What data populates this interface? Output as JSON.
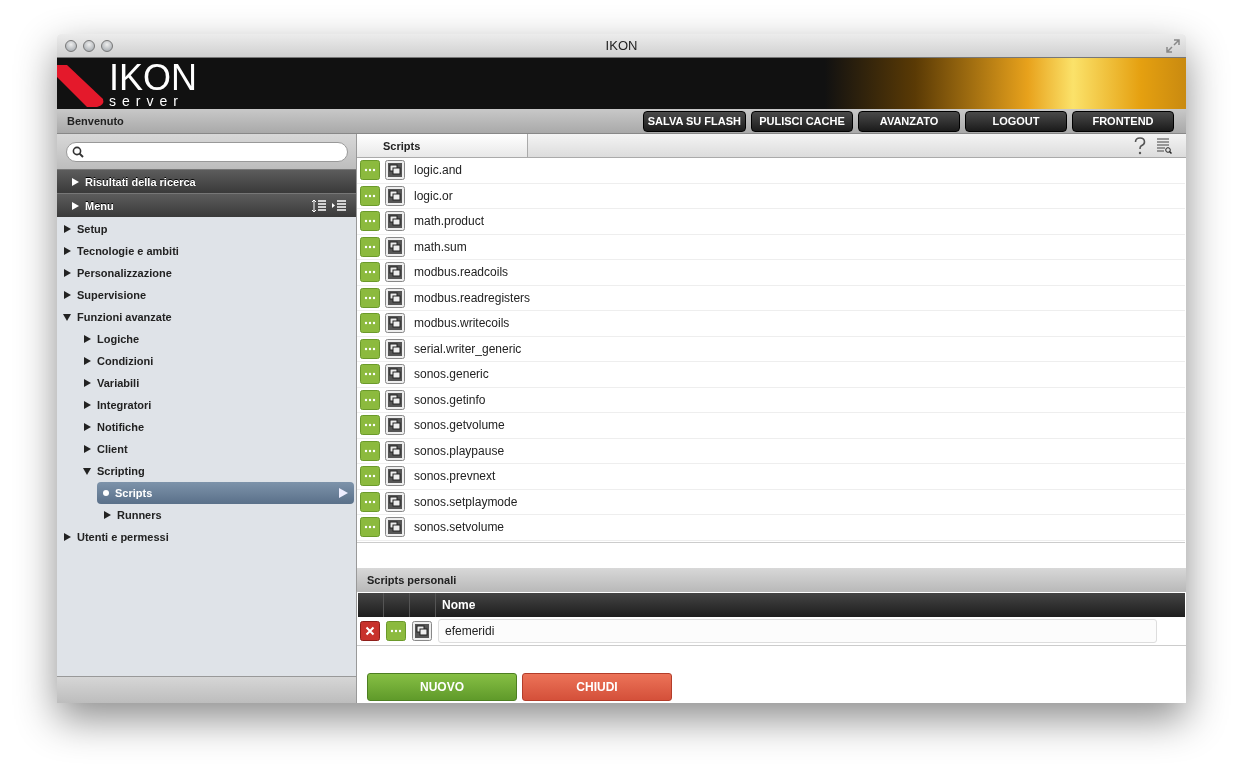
{
  "window": {
    "title": "IKON"
  },
  "logo": {
    "title": "IKON",
    "subtitle": "server"
  },
  "toolbar": {
    "greeting": "Benvenuto",
    "buttons": [
      {
        "label": "SALVA SU FLASH"
      },
      {
        "label": "PULISCI CACHE"
      },
      {
        "label": "AVANZATO"
      },
      {
        "label": "LOGOUT"
      },
      {
        "label": "FRONTEND"
      }
    ]
  },
  "sidebar": {
    "sections": [
      {
        "label": "Risultati della ricerca",
        "expanded": false
      },
      {
        "label": "Menu",
        "expanded": false
      }
    ],
    "tree": [
      {
        "label": "Setup",
        "kind": "folder",
        "expanded": false,
        "selected": false
      },
      {
        "label": "Tecnologie e ambiti",
        "kind": "folder",
        "expanded": false,
        "selected": false
      },
      {
        "label": "Personalizzazione",
        "kind": "folder",
        "expanded": false,
        "selected": false
      },
      {
        "label": "Supervisione",
        "kind": "folder",
        "expanded": false,
        "selected": false
      },
      {
        "label": "Funzioni avanzate",
        "kind": "folder",
        "expanded": true,
        "selected": false,
        "children": [
          {
            "label": "Logiche",
            "kind": "folder",
            "expanded": false,
            "selected": false
          },
          {
            "label": "Condizioni",
            "kind": "folder",
            "expanded": false,
            "selected": false
          },
          {
            "label": "Variabili",
            "kind": "folder",
            "expanded": false,
            "selected": false
          },
          {
            "label": "Integratori",
            "kind": "folder",
            "expanded": false,
            "selected": false
          },
          {
            "label": "Notifiche",
            "kind": "folder",
            "expanded": false,
            "selected": false
          },
          {
            "label": "Client",
            "kind": "folder",
            "expanded": false,
            "selected": false
          },
          {
            "label": "Scripting",
            "kind": "folder",
            "expanded": true,
            "selected": false,
            "children": [
              {
                "label": "Scripts",
                "kind": "leaf",
                "selected": true
              },
              {
                "label": "Runners",
                "kind": "folder",
                "expanded": false,
                "selected": false
              }
            ]
          }
        ]
      },
      {
        "label": "Utenti e permessi",
        "kind": "folder",
        "expanded": false,
        "selected": false
      }
    ]
  },
  "tabs": [
    {
      "label": "Scripts",
      "selected": true
    }
  ],
  "scripts": [
    "logic.and",
    "logic.or",
    "math.product",
    "math.sum",
    "modbus.readcoils",
    "modbus.readregisters",
    "modbus.writecoils",
    "serial.writer_generic",
    "sonos.generic",
    "sonos.getinfo",
    "sonos.getvolume",
    "sonos.playpause",
    "sonos.prevnext",
    "sonos.setplaymode",
    "sonos.setvolume"
  ],
  "personal": {
    "title": "Scripts personali",
    "columns": [
      {
        "label": "Nome"
      }
    ],
    "rows": [
      {
        "name": "efemeridi"
      }
    ]
  },
  "actions": [
    {
      "label": "NUOVO",
      "kind": "primary"
    },
    {
      "label": "CHIUDI",
      "kind": "danger"
    }
  ]
}
